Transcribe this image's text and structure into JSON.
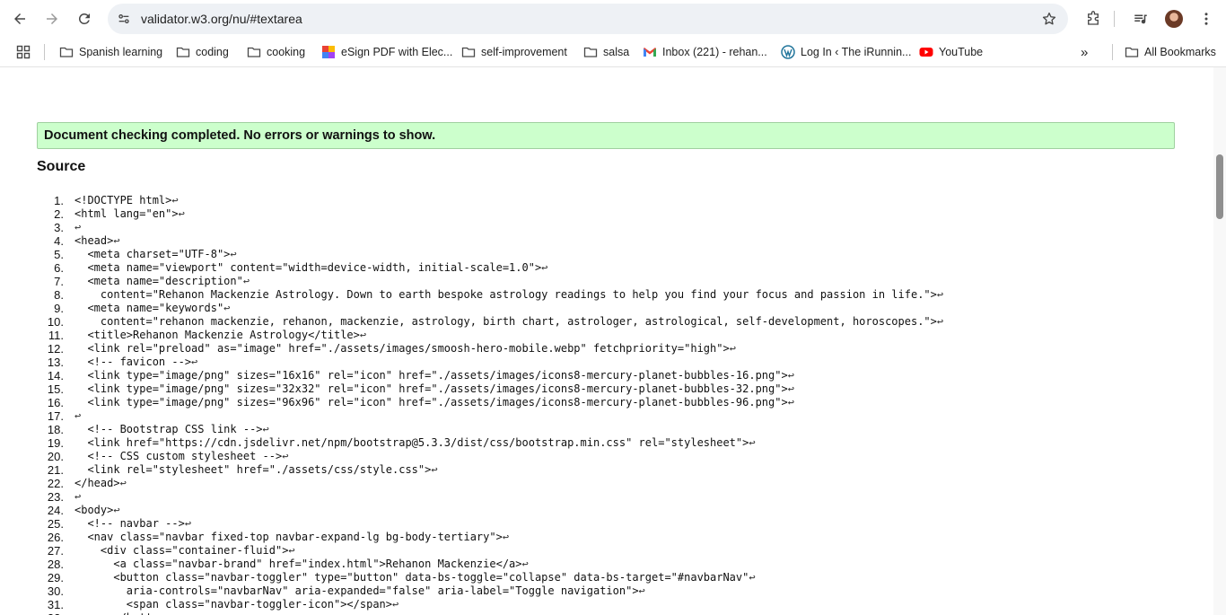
{
  "browser": {
    "url": "validator.w3.org/nu/#textarea",
    "toolbar_icons": [
      "back-icon",
      "forward-icon",
      "reload-icon",
      "site-info-icon",
      "bookmark-star-icon",
      "extensions-icon",
      "media-control-icon",
      "avatar",
      "more-menu-icon"
    ]
  },
  "bookmarks": {
    "items": [
      {
        "label": "Spanish learning",
        "icon": "folder"
      },
      {
        "label": "coding",
        "icon": "folder"
      },
      {
        "label": "cooking",
        "icon": "folder"
      },
      {
        "label": "eSign PDF with Elec...",
        "icon": "esign"
      },
      {
        "label": "self-improvement",
        "icon": "folder"
      },
      {
        "label": "salsa",
        "icon": "folder"
      },
      {
        "label": "Inbox (221) - rehan...",
        "icon": "gmail"
      },
      {
        "label": "Log In ‹ The iRunnin...",
        "icon": "wordpress"
      },
      {
        "label": "YouTube",
        "icon": "youtube"
      }
    ],
    "overflow": "»",
    "all_bookmarks": "All Bookmarks"
  },
  "result": {
    "message": "Document checking completed. No errors or warnings to show."
  },
  "source": {
    "heading": "Source",
    "eol_glyph": "↩",
    "lines": [
      "<!DOCTYPE html>",
      "<html lang=\"en\">",
      "",
      "<head>",
      "  <meta charset=\"UTF-8\">",
      "  <meta name=\"viewport\" content=\"width=device-width, initial-scale=1.0\">",
      "  <meta name=\"description\"",
      "    content=\"Rehanon Mackenzie Astrology. Down to earth bespoke astrology readings to help you find your focus and passion in life.\">",
      "  <meta name=\"keywords\"",
      "    content=\"rehanon mackenzie, rehanon, mackenzie, astrology, birth chart, astrologer, astrological, self-development, horoscopes.\">",
      "  <title>Rehanon Mackenzie Astrology</title>",
      "  <link rel=\"preload\" as=\"image\" href=\"./assets/images/smoosh-hero-mobile.webp\" fetchpriority=\"high\">",
      "  <!-- favicon -->",
      "  <link type=\"image/png\" sizes=\"16x16\" rel=\"icon\" href=\"./assets/images/icons8-mercury-planet-bubbles-16.png\">",
      "  <link type=\"image/png\" sizes=\"32x32\" rel=\"icon\" href=\"./assets/images/icons8-mercury-planet-bubbles-32.png\">",
      "  <link type=\"image/png\" sizes=\"96x96\" rel=\"icon\" href=\"./assets/images/icons8-mercury-planet-bubbles-96.png\">",
      "",
      "  <!-- Bootstrap CSS link -->",
      "  <link href=\"https://cdn.jsdelivr.net/npm/bootstrap@5.3.3/dist/css/bootstrap.min.css\" rel=\"stylesheet\">",
      "  <!-- CSS custom stylesheet -->",
      "  <link rel=\"stylesheet\" href=\"./assets/css/style.css\">",
      "</head>",
      "",
      "<body>",
      "  <!-- navbar -->",
      "  <nav class=\"navbar fixed-top navbar-expand-lg bg-body-tertiary\">",
      "    <div class=\"container-fluid\">",
      "      <a class=\"navbar-brand\" href=\"index.html\">Rehanon Mackenzie</a>",
      "      <button class=\"navbar-toggler\" type=\"button\" data-bs-toggle=\"collapse\" data-bs-target=\"#navbarNav\"",
      "        aria-controls=\"navbarNav\" aria-expanded=\"false\" aria-label=\"Toggle navigation\">",
      "        <span class=\"navbar-toggler-icon\"></span>",
      "      </button>"
    ]
  }
}
